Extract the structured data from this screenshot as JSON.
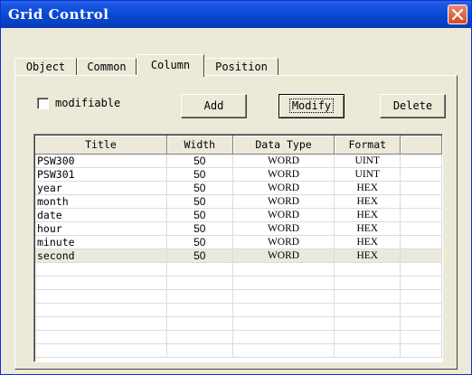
{
  "window": {
    "title": "Grid Control"
  },
  "tabs": [
    {
      "label": "Object",
      "active": false
    },
    {
      "label": "Common",
      "active": false
    },
    {
      "label": "Column",
      "active": true
    },
    {
      "label": "Position",
      "active": false
    }
  ],
  "options": {
    "modifiable_label": "modifiable",
    "modifiable_checked": false
  },
  "buttons": {
    "add": "Add",
    "modify": "Modify",
    "delete": "Delete"
  },
  "grid": {
    "columns": [
      "Title",
      "Width",
      "Data Type",
      "Format"
    ],
    "rows": [
      {
        "title": "PSW300",
        "width": "50",
        "type": "WORD",
        "format": "UINT"
      },
      {
        "title": "PSW301",
        "width": "50",
        "type": "WORD",
        "format": "UINT"
      },
      {
        "title": "year",
        "width": "50",
        "type": "WORD",
        "format": "HEX"
      },
      {
        "title": "month",
        "width": "50",
        "type": "WORD",
        "format": "HEX"
      },
      {
        "title": "date",
        "width": "50",
        "type": "WORD",
        "format": "HEX"
      },
      {
        "title": "hour",
        "width": "50",
        "type": "WORD",
        "format": "HEX"
      },
      {
        "title": "minute",
        "width": "50",
        "type": "WORD",
        "format": "HEX"
      },
      {
        "title": "second",
        "width": "50",
        "type": "WORD",
        "format": "HEX"
      }
    ],
    "selected_row": 7,
    "empty_rows": 7
  },
  "colors": {
    "titlebar": "#0a49d6",
    "dialog": "#ece9d8",
    "close": "#d14a26"
  }
}
